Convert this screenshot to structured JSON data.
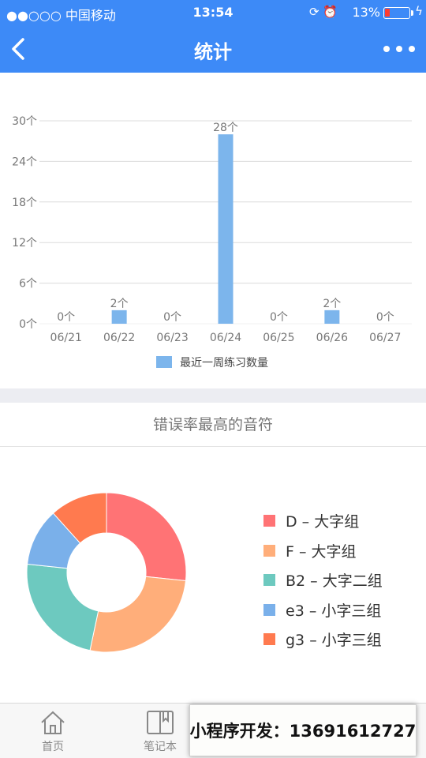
{
  "status_bar": {
    "carrier": "●●○○○ 中国移动",
    "time": "13:54",
    "battery": "13%"
  },
  "nav": {
    "title": "统计"
  },
  "chart_data": {
    "type": "bar",
    "categories": [
      "06/21",
      "06/22",
      "06/23",
      "06/24",
      "06/25",
      "06/26",
      "06/27"
    ],
    "values": [
      0,
      2,
      0,
      28,
      0,
      2,
      0
    ],
    "value_labels": [
      "0个",
      "2个",
      "0个",
      "28个",
      "0个",
      "2个",
      "0个"
    ],
    "yticks": [
      0,
      6,
      12,
      18,
      24,
      30
    ],
    "ytick_labels": [
      "0个",
      "6个",
      "12个",
      "18个",
      "24个",
      "30个"
    ],
    "ylim": [
      0,
      30
    ],
    "series": [
      {
        "name": "最近一周练习数量",
        "values": [
          0,
          2,
          0,
          28,
          0,
          2,
          0
        ]
      }
    ],
    "bar_color": "#7cb5ec",
    "legend_position": "bottom-center",
    "grid": true
  },
  "pie": {
    "title": "错误率最高的音符",
    "type": "donut",
    "slices": [
      {
        "name": "D – 大字组",
        "value": 1.6,
        "color": "#ff7375"
      },
      {
        "name": "F – 大字组",
        "value": 1.6,
        "color": "#ffae7a"
      },
      {
        "name": "B2 – 大字二组",
        "value": 1.4,
        "color": "#6dc9bf"
      },
      {
        "name": "e3 – 小字三组",
        "value": 0.7,
        "color": "#7ab0ea"
      },
      {
        "name": "g3 – 小字三组",
        "value": 0.7,
        "color": "#ff7a4f"
      }
    ]
  },
  "tabs": [
    {
      "label": "首页",
      "icon": "home-icon"
    },
    {
      "label": "笔记本",
      "icon": "notebook-icon"
    }
  ],
  "promo": {
    "text": "小程序开发：13691612727"
  }
}
